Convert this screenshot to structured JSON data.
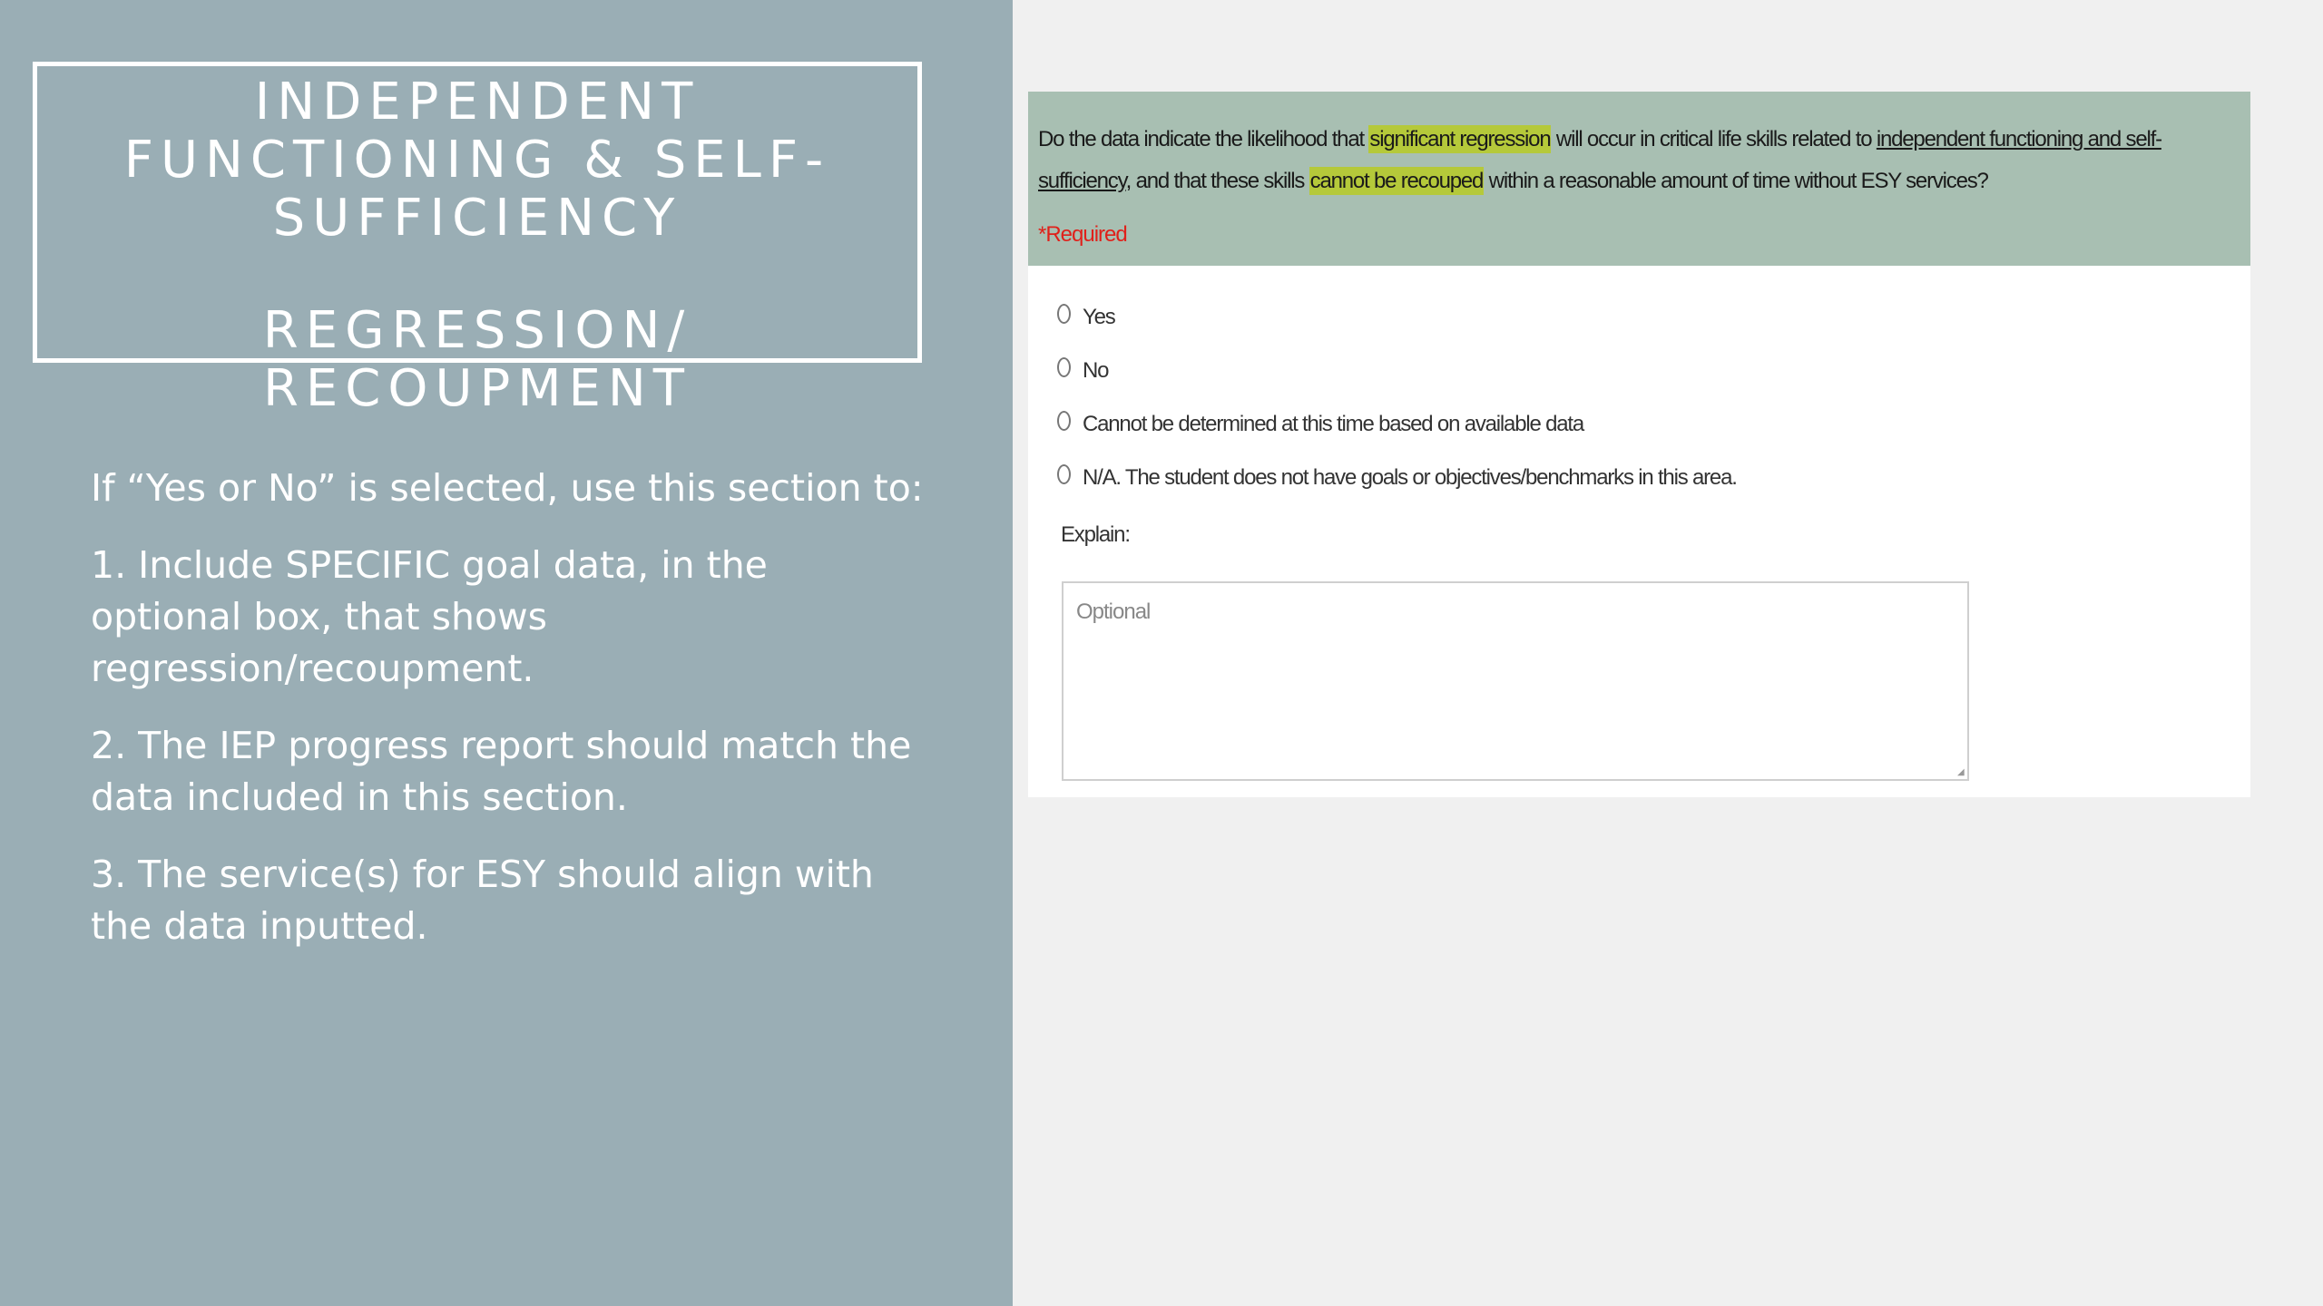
{
  "slide": {
    "title_lines": [
      "INDEPENDENT",
      "FUNCTIONING & SELF-",
      "SUFFICIENCY"
    ],
    "subtitle": "REGRESSION/ RECOUPMENT",
    "paragraphs": [
      "If “Yes or No” is selected, use this section to:",
      "1. Include SPECIFIC goal data, in the optional box,  that shows regression/recoupment.",
      "2.  The IEP progress report should match the data included in this section.",
      "3. The service(s) for ESY should align with the data inputted."
    ]
  },
  "form": {
    "question": {
      "part1": "Do the data indicate the likelihood that ",
      "highlight1": "significant regression",
      "part2": " will occur in critical life skills related to ",
      "underline1": "independent functioning and self-sufficiency",
      "part3": ", and that these skills ",
      "highlight2": "cannot be recouped",
      "part4": " within a reasonable amount of time without ESY services?"
    },
    "required_label": "*Required",
    "options": [
      "Yes",
      "No",
      "Cannot be determined at this time based on available data",
      "N/A. The student does not have goals or objectives/benchmarks in this area."
    ],
    "explain_label": "Explain:",
    "explain_placeholder": "Optional",
    "explain_value": ""
  },
  "colors": {
    "left_panel": "#9aaeb5",
    "question_header": "#a8bfb2",
    "highlight": "#b5c93a",
    "required": "#e0201a"
  }
}
